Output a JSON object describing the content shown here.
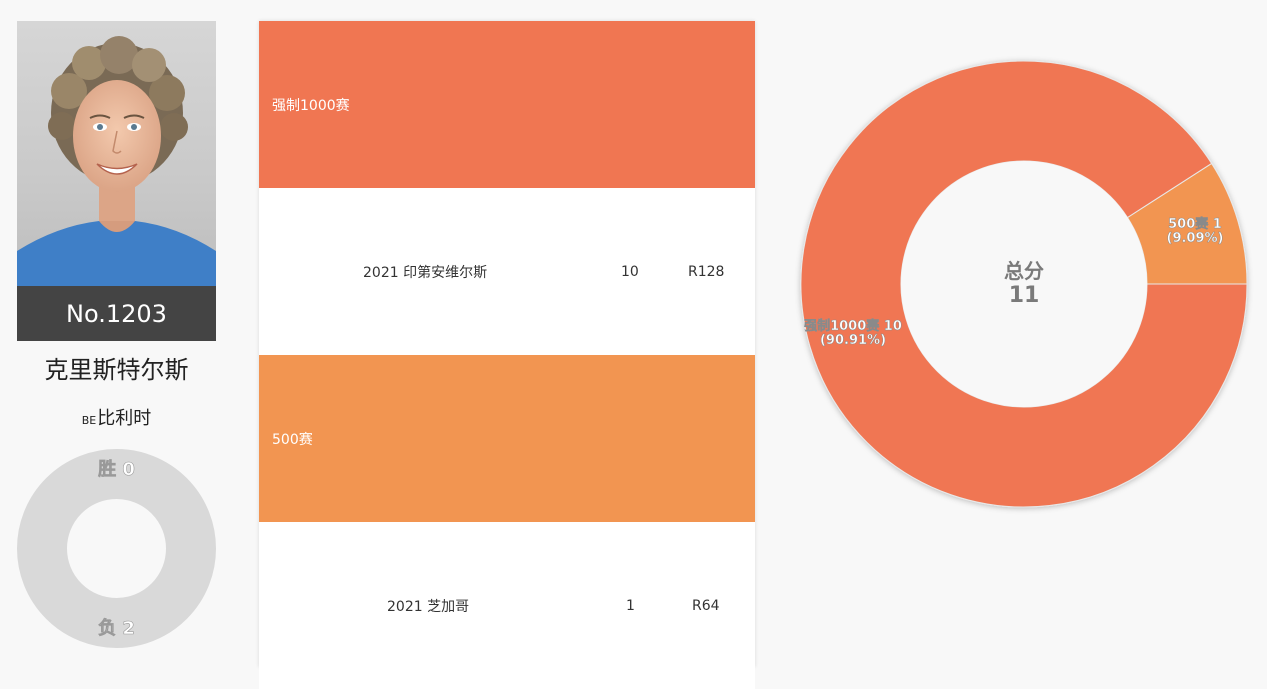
{
  "player": {
    "rank": "No.1203",
    "name": "克里斯特尔斯",
    "country_code": "BE",
    "country_name": "比利时",
    "wins_label": "胜 0",
    "losses_label": "负 2",
    "wins": 0,
    "losses": 2
  },
  "categories": [
    {
      "label": "强制1000赛",
      "color": "#f07652",
      "entries": [
        {
          "event": "2021 印第安维尔斯",
          "points": "10",
          "round": "R128"
        }
      ]
    },
    {
      "label": "500赛",
      "color": "#f29551",
      "entries": [
        {
          "event": "2021 芝加哥",
          "points": "1",
          "round": "R64"
        }
      ]
    }
  ],
  "chart_data": {
    "type": "pie",
    "center_title": "总分",
    "center_value": "11",
    "slices": [
      {
        "name": "强制1000赛",
        "value": 10,
        "label": "强制1000赛 10",
        "percent": "(90.91%)",
        "color": "#f07652"
      },
      {
        "name": "500赛",
        "value": 1,
        "label": "500赛 1",
        "percent": "(9.09%)",
        "color": "#f29551"
      }
    ]
  }
}
